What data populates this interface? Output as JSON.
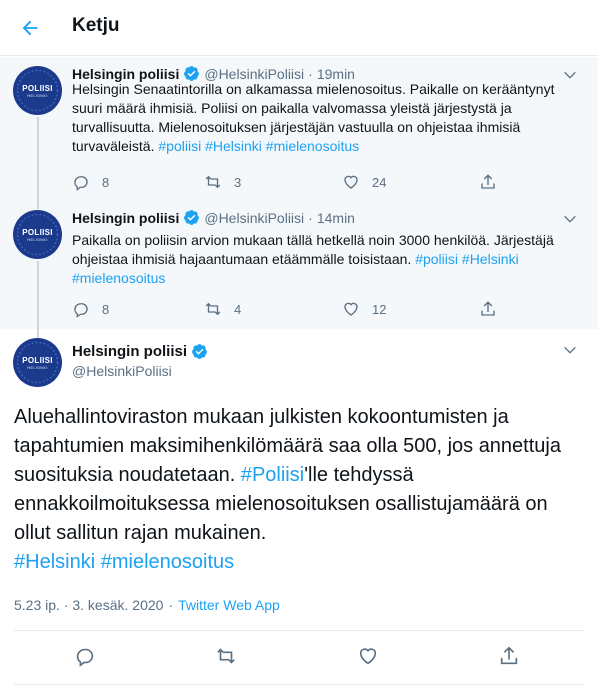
{
  "header": {
    "title": "Ketju",
    "back_icon": "arrow-left-icon",
    "accent": "#1da1f2"
  },
  "tweets": [
    {
      "author": "Helsingin poliisi",
      "handle": "@HelsinkiPoliisi",
      "separator": "·",
      "time": "19min",
      "text_plain": "Helsingin Senaatintorilla on alkamassa mielenosoitus. Paikalle on kerääntynyt suuri määrä ihmisiä. Poliisi on paikalla valvomassa yleistä järjestystä ja turvallisuutta. Mielenosoituksen järjestäjän vastuulla on ohjeistaa ihmisiä turvaväleistä.",
      "hashtags": [
        "#poliisi",
        "#Helsinki",
        "#mielenosoitus"
      ],
      "replies": "8",
      "retweets": "3",
      "likes": "24"
    },
    {
      "author": "Helsingin poliisi",
      "handle": "@HelsinkiPoliisi",
      "separator": "·",
      "time": "14min",
      "text_plain": "Paikalla on poliisin arvion mukaan tällä hetkellä noin 3000 henkilöä. Järjestäjä ohjeistaa ihmisiä hajaantumaan etäämmälle toisistaan.",
      "hashtags": [
        "#poliisi",
        "#Helsinki",
        "#mielenosoitus"
      ],
      "replies": "8",
      "retweets": "4",
      "likes": "12"
    }
  ],
  "main_tweet": {
    "author": "Helsingin poliisi",
    "handle": "@HelsinkiPoliisi",
    "text_part1": "Aluehallintoviraston mukaan julkisten kokoontumisten ja tapahtumien maksimihenkilömäärä saa olla 500, jos annettuja suosituksia noudatetaan. ",
    "hashtag_inline": "#Poliisi",
    "text_part2": "'lle tehdyssä ennakkoilmoituksessa mielenosoituksen osallistujamäärä on ollut sallitun rajan mukainen.",
    "hashtags": [
      "#Helsinki",
      "#mielenosoitus"
    ],
    "timestamp": "5.23 ip. · 3. kesäk. 2020",
    "separator": "·",
    "source": "Twitter Web App"
  },
  "avatar": {
    "label": "POLIISI",
    "sublabel": "HELSINKI",
    "color": "#1b3a8c"
  },
  "icons": {
    "verified": "verified-badge-icon",
    "caret": "chevron-down-icon",
    "reply": "reply-icon",
    "retweet": "retweet-icon",
    "like": "heart-icon",
    "share": "share-icon"
  }
}
